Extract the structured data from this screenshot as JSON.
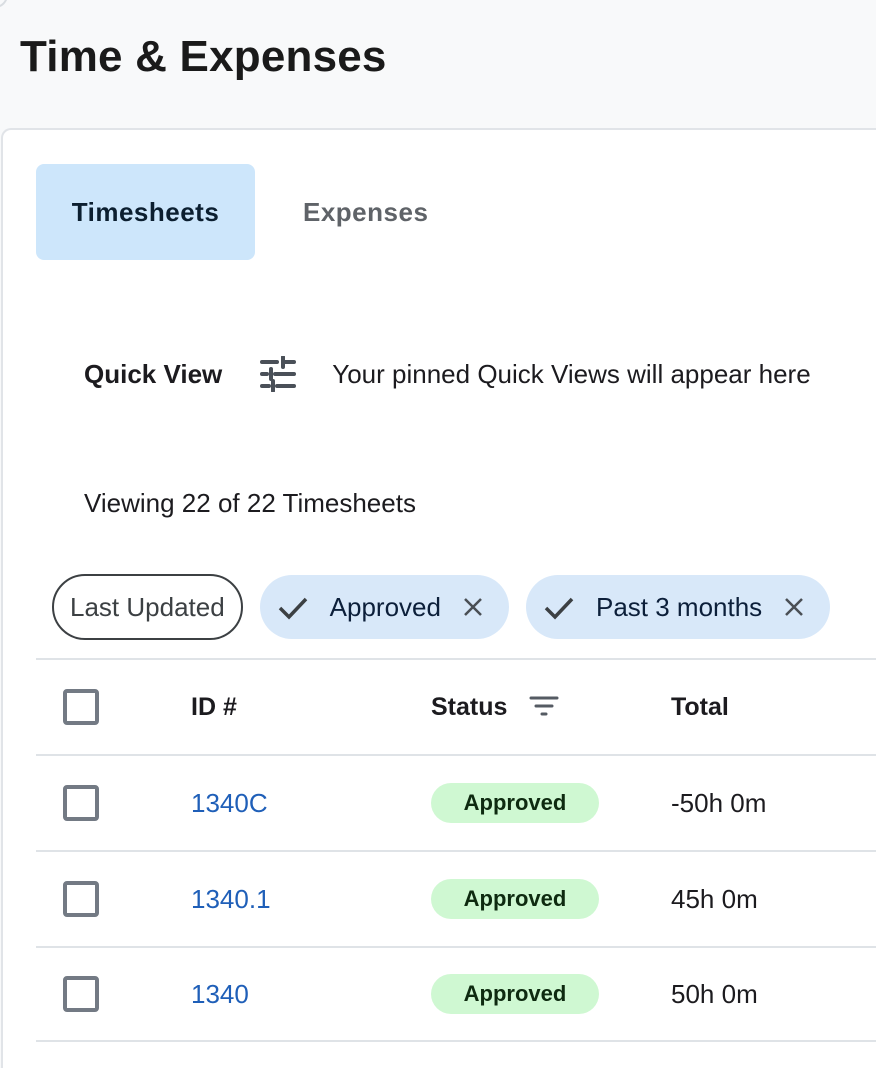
{
  "page": {
    "title": "Time & Expenses"
  },
  "tabs": [
    {
      "label": "Timesheets",
      "active": true
    },
    {
      "label": "Expenses",
      "active": false
    }
  ],
  "quick_view": {
    "label": "Quick View",
    "icon": "tune-sliders-icon",
    "hint": "Your pinned Quick Views will appear here"
  },
  "summary": {
    "viewing_text": "Viewing 22 of 22 Timesheets"
  },
  "filter_chips": [
    {
      "label": "Last Updated",
      "style": "outline",
      "selected": false
    },
    {
      "label": "Approved",
      "style": "filled",
      "selected": true,
      "removable": true
    },
    {
      "label": "Past 3 months",
      "style": "filled",
      "selected": true,
      "removable": true
    }
  ],
  "table": {
    "columns": [
      {
        "key": "select",
        "label": ""
      },
      {
        "key": "id",
        "label": "ID #"
      },
      {
        "key": "status",
        "label": "Status",
        "icon": "filter-icon"
      },
      {
        "key": "total",
        "label": "Total"
      }
    ],
    "rows": [
      {
        "id": "1340C",
        "status": "Approved",
        "total": "-50h 0m",
        "checked": false
      },
      {
        "id": "1340.1",
        "status": "Approved",
        "total": "45h 0m",
        "checked": false
      },
      {
        "id": "1340",
        "status": "Approved",
        "total": "50h 0m",
        "checked": false
      }
    ]
  },
  "colors": {
    "active_tab_bg": "#cde6fb",
    "chip_bg": "#d8e8f9",
    "link": "#1f5fb8",
    "badge_approved_bg": "#cff8d2",
    "badge_approved_text": "#0e2a10"
  }
}
